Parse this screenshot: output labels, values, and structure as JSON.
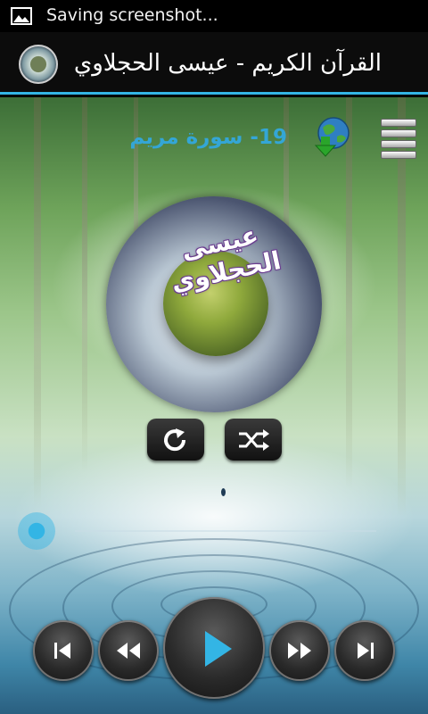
{
  "status_bar": {
    "notification_icon": "image-icon",
    "text": "Saving screenshot..."
  },
  "action_bar": {
    "logo": "app-logo-icon",
    "title": "القرآن الكريم - عيسى الحجلاوي"
  },
  "player": {
    "surah_title": "19- سورة مريم",
    "reciter_name": "عيسى الحجلاوي",
    "download_icon": "globe-download-icon",
    "menu_icon": "menu-icon",
    "repeat_icon": "repeat-icon",
    "shuffle_icon": "shuffle-icon",
    "progress_fraction": 0.0
  },
  "controls": [
    {
      "name": "skip-previous-icon"
    },
    {
      "name": "rewind-icon"
    },
    {
      "name": "play-icon"
    },
    {
      "name": "fast-forward-icon"
    },
    {
      "name": "skip-next-icon"
    }
  ],
  "colors": {
    "accent": "#33b5e5",
    "surah_title": "#34a6d6",
    "reciter_outline": "#6a3d8f"
  }
}
